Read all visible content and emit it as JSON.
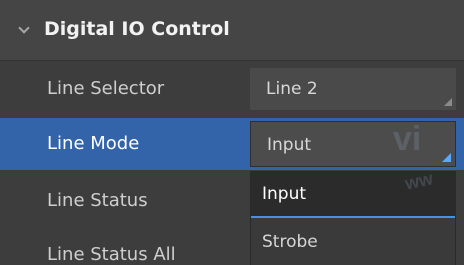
{
  "section": {
    "title": "Digital IO Control"
  },
  "rows": [
    {
      "label": "Line Selector",
      "value": "Line 2"
    },
    {
      "label": "Line Mode",
      "value": "Input"
    },
    {
      "label": "Line Status"
    },
    {
      "label": "Line Status All"
    }
  ],
  "dropdown": {
    "options": [
      "Input",
      "Strobe"
    ]
  },
  "watermark": {
    "text_big": "vi",
    "text_small": "ww"
  },
  "colors": {
    "selected_row": "#3363a8",
    "accent": "#4a90e2",
    "background": "#3d3d3d"
  },
  "icons": {
    "section_toggle": "chevron-down-icon"
  }
}
